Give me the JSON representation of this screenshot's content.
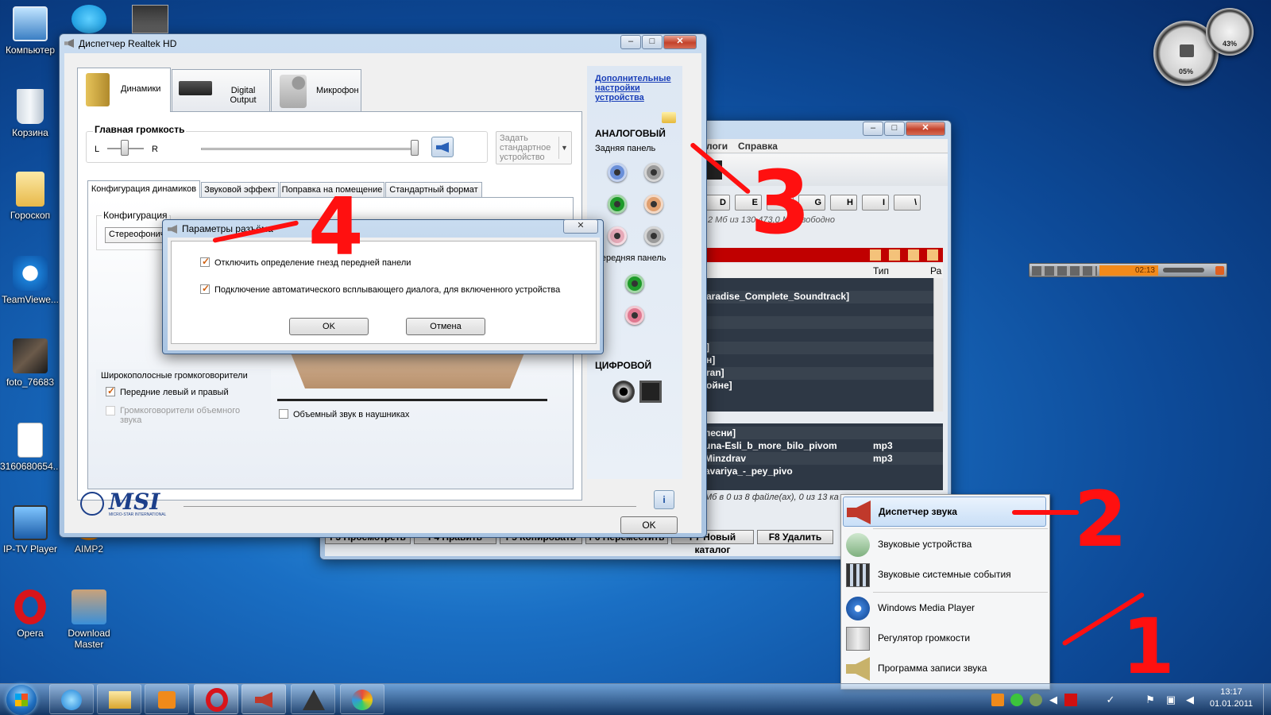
{
  "desktop": {
    "icons": [
      {
        "label": "Компьютер"
      },
      {
        "label": "Корзина"
      },
      {
        "label": "Гороскоп"
      },
      {
        "label": "TeamViewe..."
      },
      {
        "label": "foto_76683"
      },
      {
        "label": "3160680654..."
      },
      {
        "label": "IP-TV Player"
      },
      {
        "label": "AIMP2"
      },
      {
        "label": "Opera"
      },
      {
        "label": "Download Master"
      }
    ]
  },
  "gadgets": {
    "cpu": "05%",
    "ram": "43%"
  },
  "player": {
    "time": "02:13"
  },
  "realtek": {
    "title": "Диспетчер Realtek HD",
    "tabs": [
      "Динамики",
      "Digital Output",
      "Микрофон"
    ],
    "main_volume": "Главная громкость",
    "left": "L",
    "right": "R",
    "set_default": "Задать стандартное устройство",
    "subtabs": [
      "Конфигурация динамиков",
      "Звуковой эффект",
      "Поправка на помещение",
      "Стандартный формат"
    ],
    "config_label": "Конфигурация",
    "config_value": "Стереофонический",
    "wideband_title": "Широкополосные громкоговорители",
    "front_lr": "Передние левый и правый",
    "surround_speakers": "Громкоговорители объемного звука",
    "headphone_surround": "Объемный звук в наушниках",
    "advanced_link": "Дополнительные настройки устройства",
    "analog": "АНАЛОГОВЫЙ",
    "rear_panel": "Задняя панель",
    "front_panel": "Передняя панель",
    "digital": "ЦИФРОВОЙ",
    "logo": "MSI",
    "logo_sub": "MICRO-STAR INTERNATIONAL",
    "ok": "OK"
  },
  "params": {
    "title": "Параметры разъёма",
    "opt1": "Отключить определение гнезд передней панели",
    "opt2": "Подключение автоматического всплывающего диалога, для включенного устройства",
    "ok": "OK",
    "cancel": "Отмена"
  },
  "filemgr": {
    "menu": [
      "логи",
      "Справка"
    ],
    "drives": [
      "D",
      "E",
      "F",
      "G",
      "H",
      "I",
      "\\"
    ],
    "space": "2 Мб из  130 473,0 Мб свободно",
    "col_type": "Тип",
    "col_size": "Ра",
    "rows_top": [
      "aradise_Complete_Soundtrack]",
      "",
      "",
      "",
      "]",
      "н]",
      "ran]",
      "ойне]"
    ],
    "rows_bottom": [
      {
        "name": "песни]",
        "type": ""
      },
      {
        "name": "una-Esli_b_more_bilo_pivom",
        "type": "mp3"
      },
      {
        "name": "Minzdrav",
        "type": "mp3"
      },
      {
        "name": "avariya_-_pey_pivo",
        "type": ""
      }
    ],
    "status": "Мб в 0 из 8 файле(ах), 0 из 13 ка",
    "fkeys": [
      "F3 Просмотреть",
      "F4 Править",
      "F5 Копировать",
      "F6 Переместить",
      "F7 Новый каталог",
      "F8 Удалить"
    ]
  },
  "context_menu": {
    "items": [
      "Диспетчер звука",
      "Звуковые устройства",
      "Звуковые системные события",
      "Windows Media Player",
      "Регулятор громкости",
      "Программа записи звука"
    ]
  },
  "taskbar": {
    "time": "13:17",
    "date": "01.01.2011"
  },
  "annotations": [
    "1",
    "2",
    "3",
    "4"
  ]
}
